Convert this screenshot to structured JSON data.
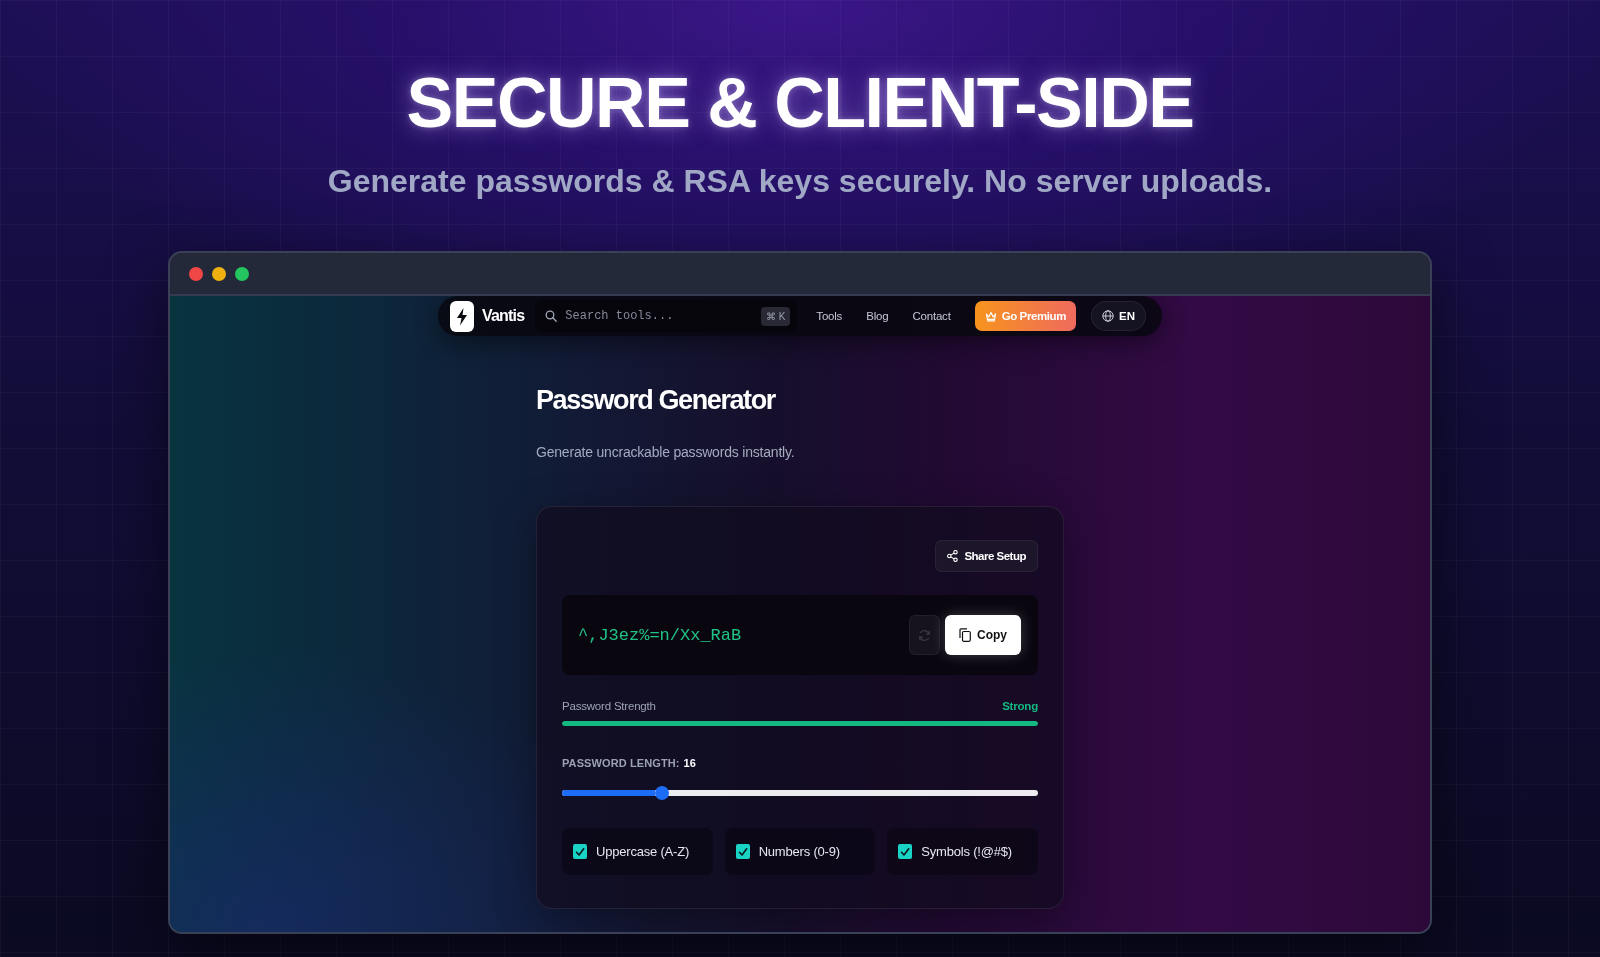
{
  "hero": {
    "title": "SECURE & CLIENT-SIDE",
    "subtitle": "Generate passwords & RSA keys securely. No server uploads."
  },
  "window": {
    "controls": [
      {
        "color": "#f04646"
      },
      {
        "color": "#eeb10f"
      },
      {
        "color": "#22c55e"
      }
    ]
  },
  "nav": {
    "brand": "Vantis",
    "search": {
      "placeholder": "Search tools...",
      "shortcut": "⌘ K"
    },
    "links": [
      "Tools",
      "Blog",
      "Contact"
    ],
    "premium_button": "Go Premium",
    "language": "EN"
  },
  "page": {
    "title": "Password Generator",
    "subtitle": "Generate uncrackable passwords instantly."
  },
  "generator": {
    "share_button": "Share Setup",
    "password": "^,J3ez%=n/Xx_RaB",
    "copy_button": "Copy",
    "strength": {
      "label": "Password Strength",
      "rating": "Strong",
      "level": 1
    },
    "length": {
      "label": "PASSWORD LENGTH:",
      "value": "16",
      "level": 0.21
    },
    "options": [
      {
        "label": "Uppercase (A-Z)",
        "checked": true
      },
      {
        "label": "Numbers (0-9)",
        "checked": true
      },
      {
        "label": "Symbols (!@#$)",
        "checked": true
      }
    ]
  }
}
